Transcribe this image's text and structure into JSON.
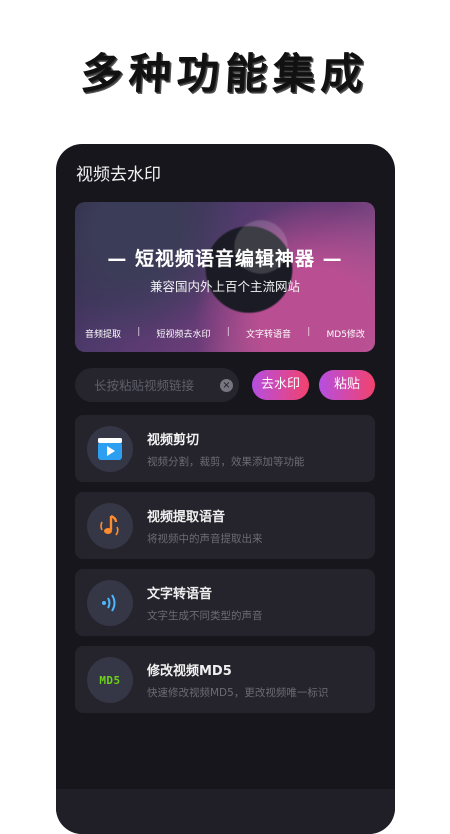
{
  "headline": "多种功能集成",
  "page": {
    "title": "视频去水印"
  },
  "banner": {
    "title": "— 短视频语音编辑神器 —",
    "subtitle": "兼容国内外上百个主流网站",
    "features": [
      "音频提取",
      "短视频去水印",
      "文字转语音",
      "MD5修改"
    ],
    "separator": "|"
  },
  "search": {
    "placeholder": "长按粘贴视频链接",
    "value": "",
    "clear_symbol": "×",
    "remove_watermark_label": "去水印",
    "paste_label": "粘贴"
  },
  "features": [
    {
      "title": "视频剪切",
      "desc": "视频分割，裁剪，效果添加等功能",
      "icon": "video-cut-icon"
    },
    {
      "title": "视频提取语音",
      "desc": "将视频中的声音提取出来",
      "icon": "music-note-icon"
    },
    {
      "title": "文字转语音",
      "desc": "文字生成不同类型的声音",
      "icon": "sound-wave-icon"
    },
    {
      "title": "修改视频MD5",
      "desc": "快速修改视频MD5，更改视频唯一标识",
      "icon": "md5-icon",
      "icon_text": "MD5"
    }
  ],
  "colors": {
    "phone_bg": "#17161c",
    "card_bg": "#25242c",
    "accent_gradient_start": "#b54fe0",
    "accent_gradient_end": "#f2426d",
    "md5_green": "#6bd11a"
  }
}
